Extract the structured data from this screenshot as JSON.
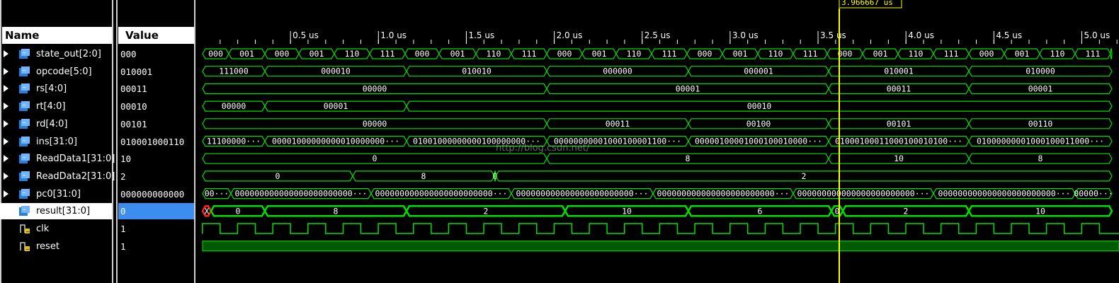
{
  "columns": {
    "name": "Name",
    "value": "Value"
  },
  "cursor_label": "3.966667 us",
  "watermark": "http://blog.csdn.net/",
  "time_ticks": [
    "0.5 us",
    "1.0 us",
    "1.5 us",
    "2.0 us",
    "2.5 us",
    "3.0 us",
    "3.5 us",
    "4.0 us",
    "4.5 us",
    "5.0 us"
  ],
  "signals": [
    {
      "name": "state_out[2:0]",
      "value": "000",
      "type": "bus",
      "expandable": true,
      "segments": [
        "000",
        "001",
        "000",
        "001",
        "110",
        "111",
        "000",
        "001",
        "110",
        "111",
        "000",
        "001",
        "110",
        "111",
        "000",
        "001",
        "110",
        "111",
        "000",
        "001",
        "110",
        "111",
        "000",
        "001",
        "110",
        "111",
        ""
      ]
    },
    {
      "name": "opcode[5:0]",
      "value": "010001",
      "type": "bus",
      "expandable": true,
      "segments": [
        "111000",
        "000010",
        "010010",
        "000000",
        "000001",
        "010001",
        "010000"
      ]
    },
    {
      "name": "rs[4:0]",
      "value": "00011",
      "type": "bus",
      "expandable": true,
      "segments": [
        "00000",
        "00001",
        "00011",
        "00001"
      ]
    },
    {
      "name": "rt[4:0]",
      "value": "00010",
      "type": "bus",
      "expandable": true,
      "segments": [
        "00000",
        "00001",
        "00010"
      ]
    },
    {
      "name": "rd[4:0]",
      "value": "00101",
      "type": "bus",
      "expandable": true,
      "segments": [
        "00000",
        "00011",
        "00100",
        "00101",
        "00110"
      ]
    },
    {
      "name": "ins[31:0]",
      "value": "010001000110",
      "type": "bus",
      "expandable": true,
      "segments": [
        "11100000···",
        "00001000000000010000000···",
        "01001000000000100000000···",
        "00000000001000100001100···",
        "00000100001000100010000···",
        "01000100011000100010100···",
        "01000000001000100011000···"
      ]
    },
    {
      "name": "ReadData1[31:0]",
      "value": "10",
      "type": "bus",
      "expandable": true,
      "segments": [
        "0",
        "8",
        "10",
        "8"
      ]
    },
    {
      "name": "ReadData2[31:0]",
      "value": "2",
      "type": "bus",
      "expandable": true,
      "segments": [
        "0",
        "8",
        "0",
        "2"
      ]
    },
    {
      "name": "pc0[31:0]",
      "value": "000000000000",
      "type": "bus",
      "expandable": true,
      "segments": [
        "00···",
        "000000000000000000000000···",
        "000000000000000000000000···",
        "000000000000000000000000···",
        "000000000000000000000000···",
        "000000000000000000000000···",
        "000000000000000000000000···",
        "00000···"
      ]
    },
    {
      "name": "result[31:0]",
      "value": "0",
      "type": "bus",
      "expandable": true,
      "selected": true,
      "segments": [
        "X",
        "0",
        "8",
        "2",
        "10",
        "6",
        "0",
        "2",
        "10"
      ]
    },
    {
      "name": "clk",
      "value": "1",
      "type": "bit",
      "expandable": false
    },
    {
      "name": "reset",
      "value": "1",
      "type": "bit",
      "expandable": false
    }
  ]
}
